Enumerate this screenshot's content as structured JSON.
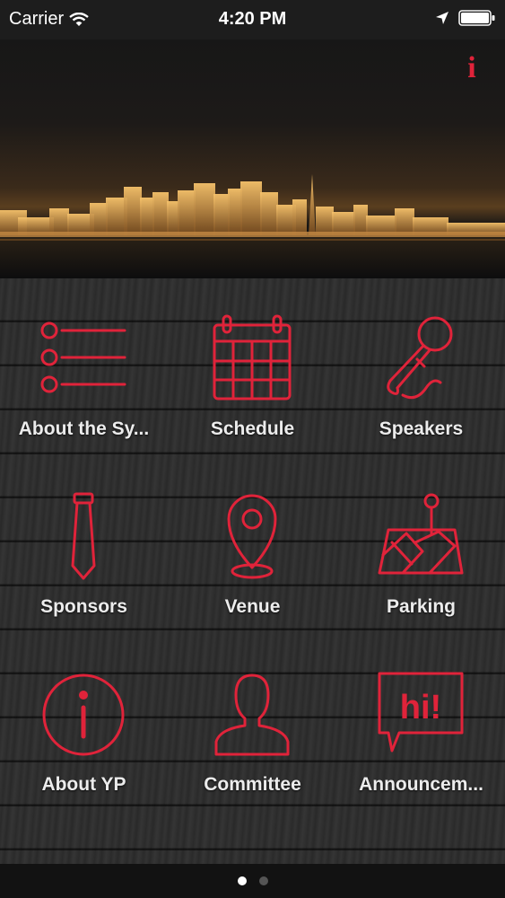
{
  "status": {
    "carrier": "Carrier",
    "time": "4:20 PM"
  },
  "header": {
    "info_glyph": "i"
  },
  "tiles": [
    {
      "label": "About the Sy...",
      "icon": "list-icon"
    },
    {
      "label": "Schedule",
      "icon": "calendar-icon"
    },
    {
      "label": "Speakers",
      "icon": "microphone-icon"
    },
    {
      "label": "Sponsors",
      "icon": "necktie-icon"
    },
    {
      "label": "Venue",
      "icon": "location-pin-icon"
    },
    {
      "label": "Parking",
      "icon": "map-pin-icon"
    },
    {
      "label": "About YP",
      "icon": "info-circle-icon"
    },
    {
      "label": "Committee",
      "icon": "person-icon"
    },
    {
      "label": "Announcem...",
      "icon": "speech-bubble-icon"
    }
  ],
  "announcement_bubble_text": "hi!",
  "pager": {
    "count": 2,
    "active_index": 0
  },
  "colors": {
    "accent": "#e0233a",
    "label": "#ececec",
    "pager_active": "#ffffff",
    "pager_inactive": "#555555"
  }
}
